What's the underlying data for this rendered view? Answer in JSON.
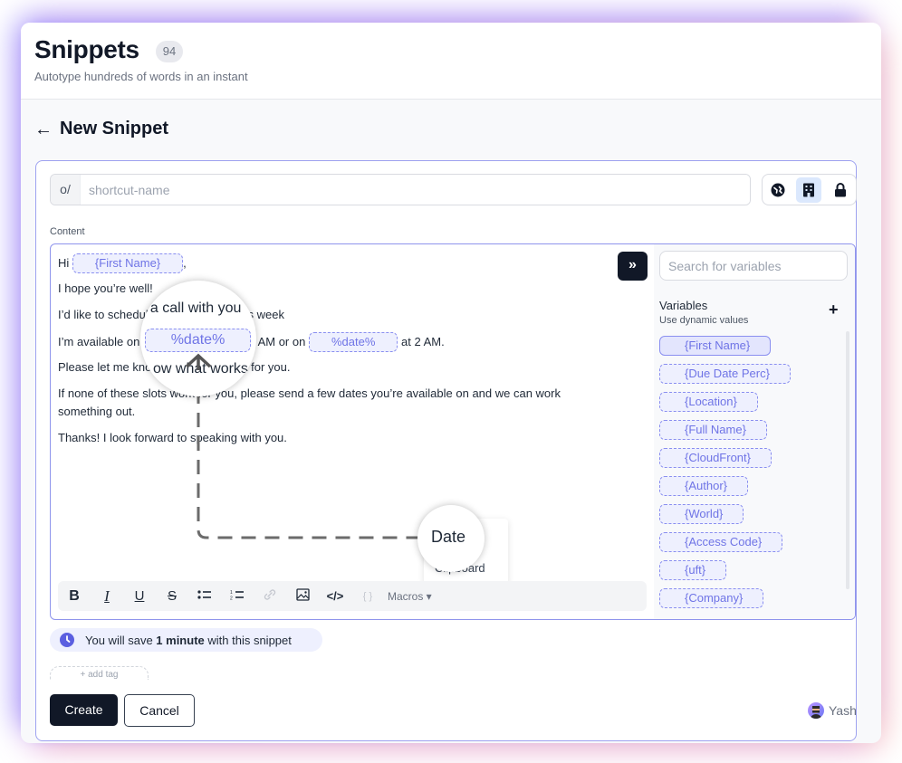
{
  "header": {
    "title": "Snippets",
    "count": "94",
    "subtitle": "Autotype hundreds of words in an instant"
  },
  "page": {
    "back_label": "←",
    "title": "New Snippet"
  },
  "shortcut": {
    "prefix": "o/",
    "placeholder": "shortcut-name",
    "value": ""
  },
  "scope_buttons": [
    {
      "icon": "globe-icon",
      "label": "Public",
      "active": false
    },
    {
      "icon": "building-icon",
      "label": "Organization",
      "active": true
    },
    {
      "icon": "lock-icon",
      "label": "Private",
      "active": false
    }
  ],
  "content_label": "Content",
  "editor": {
    "line1_prefix": "Hi",
    "line1_chip": "{First Name}",
    "line1_suffix": ",",
    "line2": "I hope you’re well!",
    "line3": "I’d like to schedule a call with you this week",
    "line4_prefix": "I’m available on",
    "line4_chip1": "%date%",
    "line4_mid": "at 1 AM or on",
    "line4_chip2": "%date%",
    "line4_suffix": "at 2 AM.",
    "line5": "Please let me know what works best for you.",
    "line6": "If none of these slots work for you, please send a few dates you’re available on and we can work something out.",
    "line7": "Thanks! I look forward to speaking with you."
  },
  "magnifier": {
    "line_a": "le a call with you",
    "chip": "%date%",
    "line_b": "ow what works",
    "date_label": "Date"
  },
  "macros_menu": {
    "items": [
      "Date",
      "Clipboard"
    ]
  },
  "toolbar": {
    "bold": "B",
    "italic": "I",
    "underline": "U",
    "strike": "S",
    "bullet_list": "•",
    "ordered_list": "1.",
    "link": "link",
    "image": "image",
    "code": "</>",
    "braces": "{ }",
    "macros_label": "Macros ▾"
  },
  "variables": {
    "search_placeholder": "Search for variables",
    "title": "Variables",
    "subtitle": "Use dynamic values",
    "add_label": "+",
    "items": [
      "{First Name}",
      "{Due Date Perc}",
      "{Location}",
      "{Full Name}",
      "{CloudFront}",
      "{Author}",
      "{World}",
      "{Access Code}",
      "{uft}",
      "{Company}"
    ],
    "selected": "{First Name}"
  },
  "save_info": {
    "prefix": "You will save ",
    "bold": "1 minute",
    "suffix": " with this snippet"
  },
  "add_tag_label": "+ add tag",
  "buttons": {
    "create": "Create",
    "cancel": "Cancel"
  },
  "author": {
    "name": "Yash"
  },
  "colors": {
    "accent": "#6f74e6",
    "chip_bg": "#eef0fe",
    "primary_button": "#111827"
  }
}
